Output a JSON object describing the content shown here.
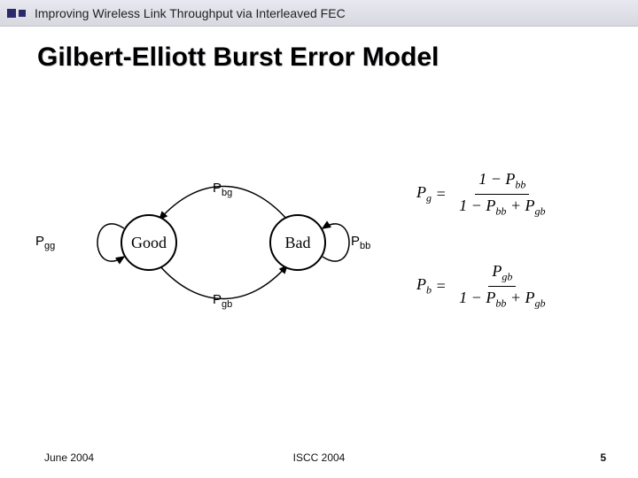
{
  "header": {
    "title": "Improving Wireless Link Throughput via Interleaved FEC"
  },
  "slide": {
    "title": "Gilbert-Elliott Burst Error Model"
  },
  "diagram": {
    "states": {
      "good": "Good",
      "bad": "Bad"
    },
    "labels": {
      "pgg": "P",
      "pgg_sub": "gg",
      "pbb": "P",
      "pbb_sub": "bb",
      "pbg": "P",
      "pbg_sub": "bg",
      "pgb": "P",
      "pgb_sub": "gb"
    }
  },
  "formulas": {
    "pg": {
      "lhs": "P",
      "lhs_sub": "g",
      "num_pre": "1 −",
      "num_p": "P",
      "num_sub": "bb",
      "den_pre": "1 −",
      "den_p1": "P",
      "den_s1": "bb",
      "den_mid": "+",
      "den_p2": "P",
      "den_s2": "gb"
    },
    "pb": {
      "lhs": "P",
      "lhs_sub": "b",
      "num_p": "P",
      "num_sub": "gb",
      "den_pre": "1 −",
      "den_p1": "P",
      "den_s1": "bb",
      "den_mid": "+",
      "den_p2": "P",
      "den_s2": "gb"
    }
  },
  "footer": {
    "left": "June 2004",
    "center": "ISCC 2004",
    "right": "5"
  }
}
